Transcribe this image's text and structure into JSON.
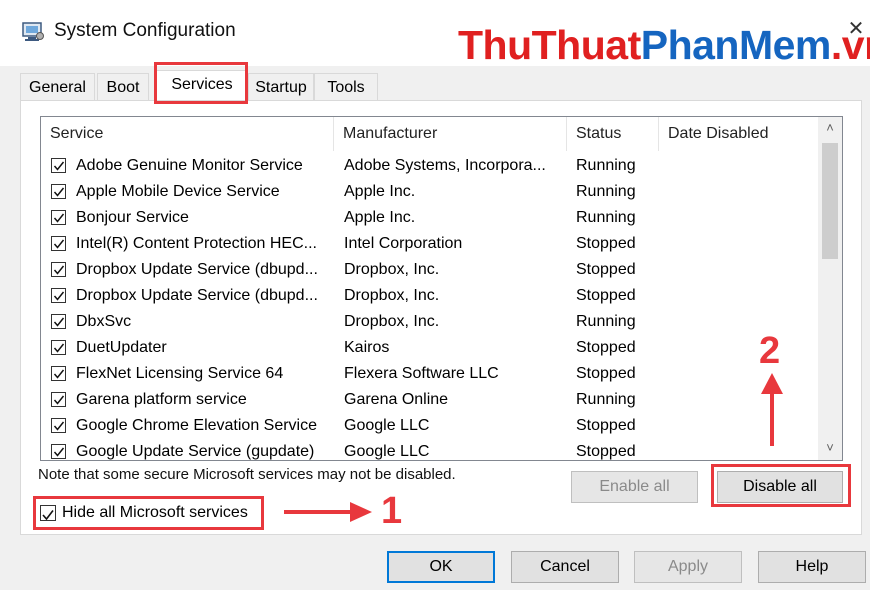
{
  "window": {
    "title": "System Configuration",
    "close_glyph": "✕",
    "icon": "msconfig-icon"
  },
  "watermark": {
    "part1": "ThuThuat",
    "part2": "PhanMem",
    "part3": ".vn",
    "colors": {
      "red": "#e02020",
      "blue": "#1565c0"
    }
  },
  "tabs": [
    {
      "label": "General",
      "active": false
    },
    {
      "label": "Boot",
      "active": false
    },
    {
      "label": "Services",
      "active": true
    },
    {
      "label": "Startup",
      "active": false
    },
    {
      "label": "Tools",
      "active": false
    }
  ],
  "table": {
    "columns": [
      "Service",
      "Manufacturer",
      "Status",
      "Date Disabled"
    ],
    "rows": [
      {
        "checked": true,
        "service": "Adobe Genuine Monitor Service",
        "manufacturer": "Adobe Systems, Incorpora...",
        "status": "Running",
        "date": ""
      },
      {
        "checked": true,
        "service": "Apple Mobile Device Service",
        "manufacturer": "Apple Inc.",
        "status": "Running",
        "date": ""
      },
      {
        "checked": true,
        "service": "Bonjour Service",
        "manufacturer": "Apple Inc.",
        "status": "Running",
        "date": ""
      },
      {
        "checked": true,
        "service": "Intel(R) Content Protection HEC...",
        "manufacturer": "Intel Corporation",
        "status": "Stopped",
        "date": ""
      },
      {
        "checked": true,
        "service": "Dropbox Update Service (dbupd...",
        "manufacturer": "Dropbox, Inc.",
        "status": "Stopped",
        "date": ""
      },
      {
        "checked": true,
        "service": "Dropbox Update Service (dbupd...",
        "manufacturer": "Dropbox, Inc.",
        "status": "Stopped",
        "date": ""
      },
      {
        "checked": true,
        "service": "DbxSvc",
        "manufacturer": "Dropbox, Inc.",
        "status": "Running",
        "date": ""
      },
      {
        "checked": true,
        "service": "DuetUpdater",
        "manufacturer": "Kairos",
        "status": "Stopped",
        "date": ""
      },
      {
        "checked": true,
        "service": "FlexNet Licensing Service 64",
        "manufacturer": "Flexera Software LLC",
        "status": "Stopped",
        "date": ""
      },
      {
        "checked": true,
        "service": "Garena platform service",
        "manufacturer": "Garena Online",
        "status": "Running",
        "date": ""
      },
      {
        "checked": true,
        "service": "Google Chrome Elevation Service",
        "manufacturer": "Google LLC",
        "status": "Stopped",
        "date": ""
      },
      {
        "checked": true,
        "service": "Google Update Service (gupdate)",
        "manufacturer": "Google LLC",
        "status": "Stopped",
        "date": ""
      }
    ],
    "scroll_up": "˄",
    "scroll_down": "˅"
  },
  "note": "Note that some secure Microsoft services may not be disabled.",
  "enable_all": "Enable all",
  "disable_all": "Disable all",
  "hide_ms": {
    "label": "Hide all Microsoft services",
    "checked": true
  },
  "buttons": {
    "ok": "OK",
    "cancel": "Cancel",
    "apply": "Apply",
    "help": "Help"
  },
  "annotations": {
    "one": "1",
    "two": "2",
    "color": "#e8383d"
  }
}
